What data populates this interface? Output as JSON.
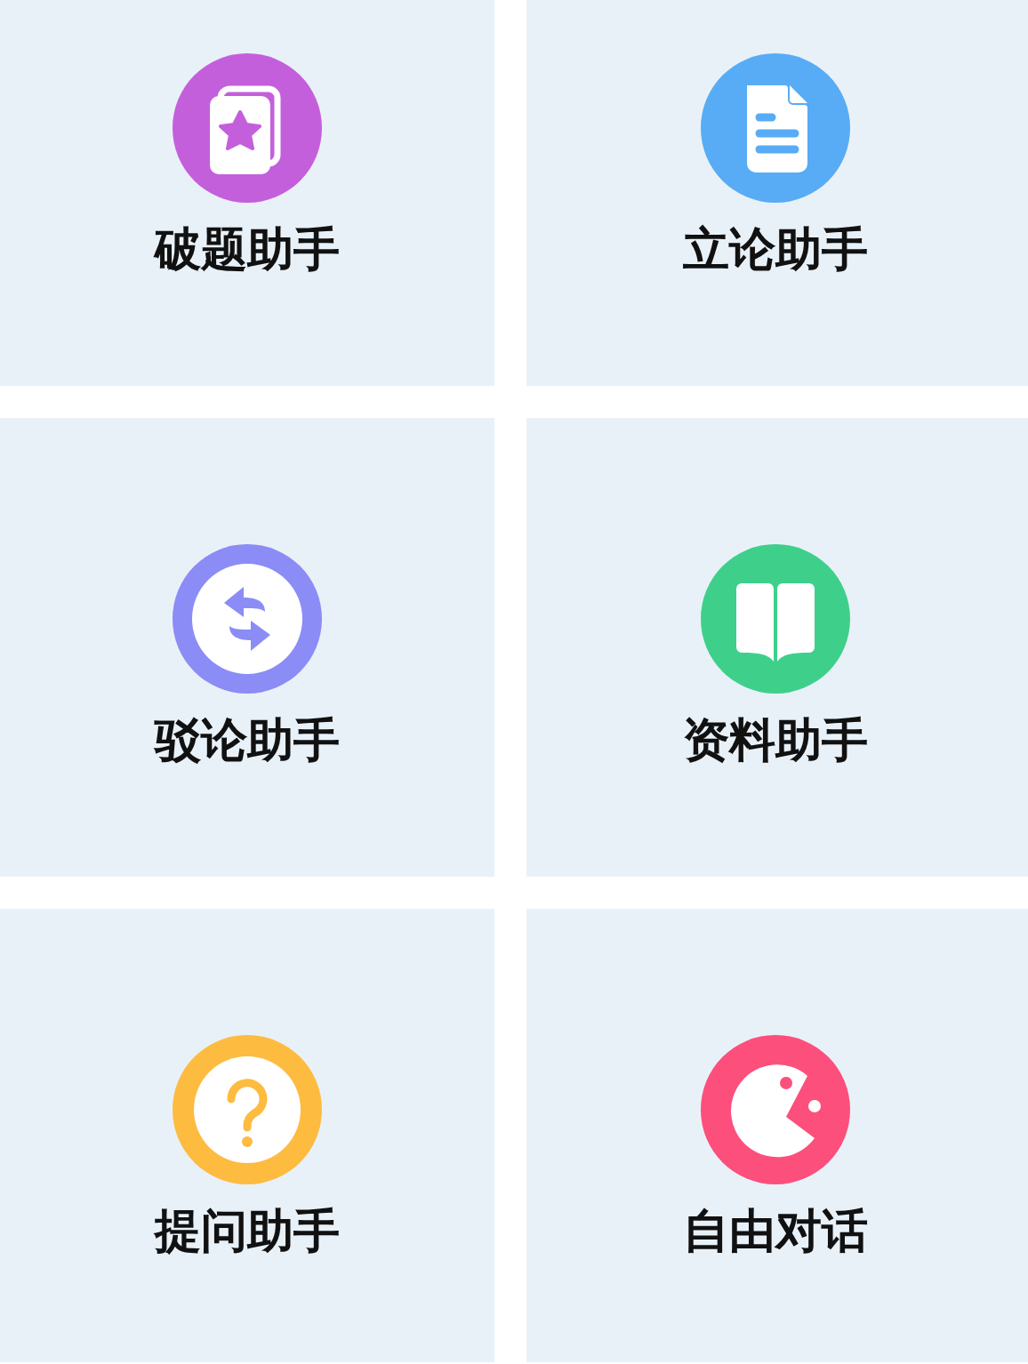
{
  "tiles": [
    {
      "label": "破题助手",
      "kind": "card-star",
      "color": "#c45fdb"
    },
    {
      "label": "立论助手",
      "kind": "document",
      "color": "#57acf5"
    },
    {
      "label": "驳论助手",
      "kind": "swap",
      "color": "#8b8cf6"
    },
    {
      "label": "资料助手",
      "kind": "book",
      "color": "#3ed08b"
    },
    {
      "label": "提问助手",
      "kind": "question",
      "color": "#fdbb40"
    },
    {
      "label": "自由对话",
      "kind": "chomp",
      "color": "#fc4f7c"
    }
  ]
}
